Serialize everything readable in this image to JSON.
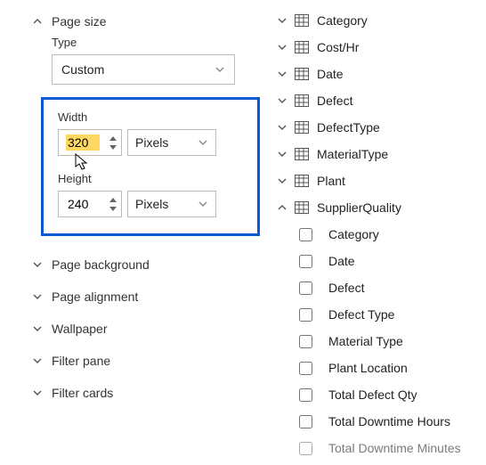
{
  "formatPanel": {
    "pageSize": {
      "header": "Page size",
      "typeLabel": "Type",
      "typeValue": "Custom",
      "widthLabel": "Width",
      "widthValue": "320",
      "widthUnit": "Pixels",
      "heightLabel": "Height",
      "heightValue": "240",
      "heightUnit": "Pixels"
    },
    "sections": [
      {
        "label": "Page background"
      },
      {
        "label": "Page alignment"
      },
      {
        "label": "Wallpaper"
      },
      {
        "label": "Filter pane"
      },
      {
        "label": "Filter cards"
      }
    ]
  },
  "fieldsPanel": {
    "tables": [
      {
        "name": "Category",
        "expanded": false
      },
      {
        "name": "Cost/Hr",
        "expanded": false
      },
      {
        "name": "Date",
        "expanded": false
      },
      {
        "name": "Defect",
        "expanded": false
      },
      {
        "name": "DefectType",
        "expanded": false
      },
      {
        "name": "MaterialType",
        "expanded": false
      },
      {
        "name": "Plant",
        "expanded": false
      },
      {
        "name": "SupplierQuality",
        "expanded": true,
        "columns": [
          "Category",
          "Date",
          "Defect",
          "Defect Type",
          "Material Type",
          "Plant Location",
          "Total Defect Qty",
          "Total Downtime Hours",
          "Total Downtime Minutes"
        ]
      }
    ]
  }
}
